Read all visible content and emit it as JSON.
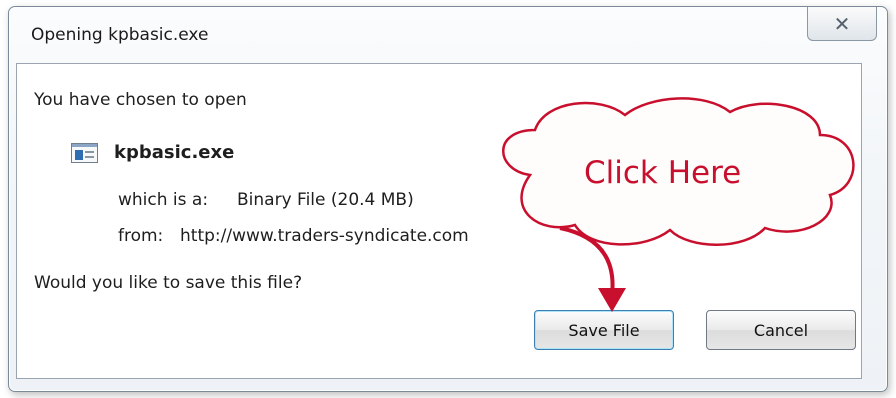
{
  "window": {
    "title": "Opening kpbasic.exe",
    "close_glyph": "✕"
  },
  "body": {
    "intro": "You have chosen to open",
    "file_name": "kpbasic.exe",
    "type_label": "which is a:",
    "type_value": "Binary File (20.4 MB)",
    "from_label": "from:",
    "from_value": "http://www.traders-syndicate.com",
    "question": "Would you like to save this file?"
  },
  "buttons": {
    "save": "Save File",
    "cancel": "Cancel"
  },
  "annotation": {
    "callout_text": "Click Here",
    "color": "#c8102e"
  }
}
